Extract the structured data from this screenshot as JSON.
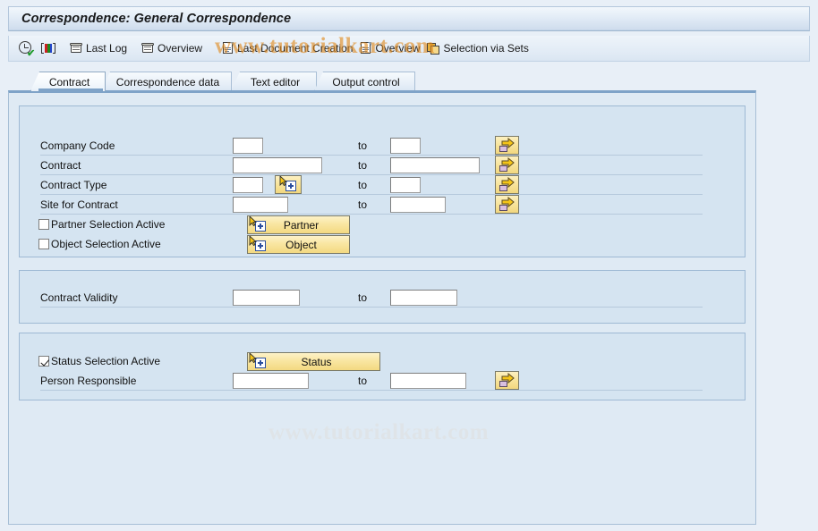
{
  "window": {
    "title": "Correspondence: General Correspondence"
  },
  "watermark": {
    "text": "www.tutorialkart.com"
  },
  "toolbar": {
    "items": [
      {
        "icon": "execute-icon",
        "label": ""
      },
      {
        "icon": "color-bars-icon",
        "label": ""
      },
      {
        "icon": "scroll-icon",
        "label": "Last Log"
      },
      {
        "icon": "scroll-icon",
        "label": "Overview"
      },
      {
        "icon": "document-icon",
        "label": "Last Document Creation"
      },
      {
        "icon": "document-icon",
        "label": "Overview"
      },
      {
        "icon": "selection-sets-icon",
        "label": "Selection via Sets"
      }
    ]
  },
  "tabs": [
    {
      "label": "Contract",
      "active": true
    },
    {
      "label": "Correspondence data",
      "active": false
    },
    {
      "label": "Text editor",
      "active": false
    },
    {
      "label": "Output control",
      "active": false
    }
  ],
  "group1": {
    "rows": [
      {
        "label": "Company Code",
        "from_value": "",
        "to_label": "to",
        "to_value": "",
        "has_arrow": true,
        "has_multi": false
      },
      {
        "label": "Contract",
        "from_value": "",
        "to_label": "to",
        "to_value": "",
        "has_arrow": true,
        "has_multi": false
      },
      {
        "label": "Contract Type",
        "from_value": "",
        "to_label": "to",
        "to_value": "",
        "has_arrow": true,
        "has_multi": true
      },
      {
        "label": "Site for Contract",
        "from_value": "",
        "to_label": "to",
        "to_value": "",
        "has_arrow": true,
        "has_multi": false
      }
    ],
    "checkboxes": [
      {
        "label": "Partner Selection Active",
        "checked": false,
        "button_label": "Partner"
      },
      {
        "label": "Object Selection Active",
        "checked": false,
        "button_label": "Object"
      }
    ]
  },
  "group2": {
    "rows": [
      {
        "label": "Contract Validity",
        "from_value": "",
        "to_label": "to",
        "to_value": ""
      }
    ]
  },
  "group3": {
    "checkbox": {
      "label": "Status Selection Active",
      "checked": true,
      "button_label": "Status"
    },
    "rows": [
      {
        "label": "Person Responsible",
        "from_value": "",
        "to_label": "to",
        "to_value": ""
      }
    ]
  },
  "colors": {
    "titlebar": "#cfdded",
    "panel_bg": "#dfeaf4",
    "group_bg": "#d5e4f1",
    "accent": "#7fa3c8",
    "button_yellow": "#f8e49b",
    "watermark": "#e08a1e"
  }
}
